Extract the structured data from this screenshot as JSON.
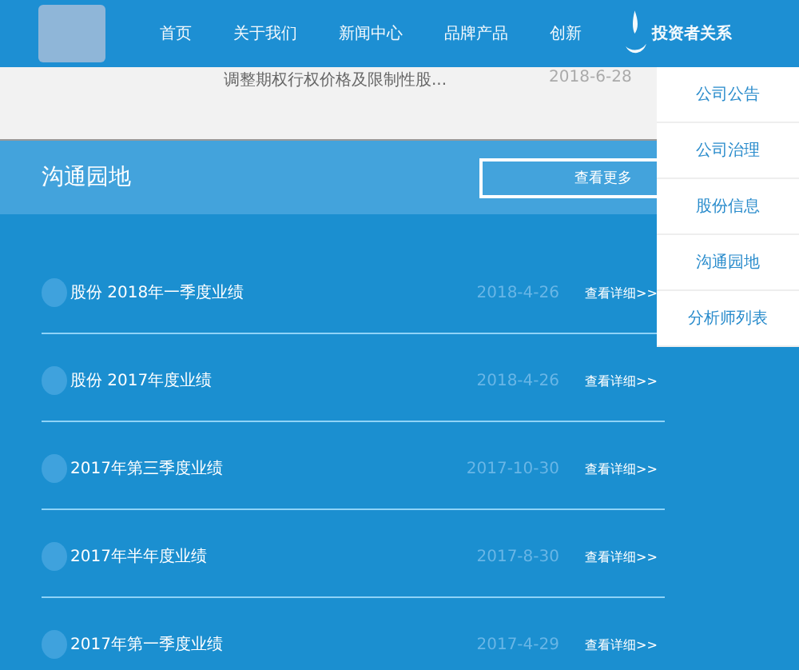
{
  "nav": {
    "items": [
      {
        "label": "首页",
        "selected": false
      },
      {
        "label": "关于我们",
        "selected": false
      },
      {
        "label": "新闻中心",
        "selected": false
      },
      {
        "label": "品牌产品",
        "selected": false
      },
      {
        "label": "创新",
        "selected": false
      },
      {
        "label": "投资者关系",
        "selected": true
      }
    ]
  },
  "previous_item": {
    "title": "调整期权行权价格及限制性股...",
    "date": "2018-6-28"
  },
  "dropdown": {
    "items": [
      "公司公告",
      "公司治理",
      "股份信息",
      "沟通园地",
      "分析师列表"
    ]
  },
  "section": {
    "title": "沟通园地",
    "more_button": "查看更多",
    "rows": [
      {
        "title": "股份 2018年一季度业绩",
        "date": "2018-4-26",
        "link": "查看详细>>"
      },
      {
        "title": "股份 2017年度业绩",
        "date": "2018-4-26",
        "link": "查看详细>>"
      },
      {
        "title": "2017年第三季度业绩",
        "date": "2017-10-30",
        "link": "查看详细>>"
      },
      {
        "title": "2017年半年度业绩",
        "date": "2017-8-30",
        "link": "查看详细>>"
      },
      {
        "title": "2017年第一季度业绩",
        "date": "2017-4-29",
        "link": "查看详细>>"
      }
    ]
  }
}
